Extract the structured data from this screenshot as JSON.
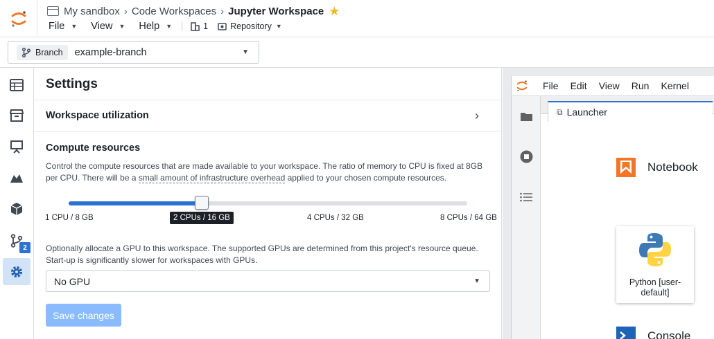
{
  "header": {
    "breadcrumb": [
      "My sandbox",
      "Code Workspaces",
      "Jupyter Workspace"
    ],
    "menu": [
      "File",
      "View",
      "Help"
    ],
    "meta": {
      "count": "1",
      "repository": "Repository"
    }
  },
  "branch": {
    "tag": "Branch",
    "name": "example-branch"
  },
  "rail": {
    "badge": "2",
    "icons": [
      "table-icon",
      "archive-icon",
      "presentation-icon",
      "mountain-chart-icon",
      "cube-icon",
      "git-branch-icon",
      "gear-icon"
    ]
  },
  "settings": {
    "title": "Settings",
    "utilization_label": "Workspace utilization",
    "compute_title": "Compute resources",
    "compute_desc_1": "Control the compute resources that are made available to your workspace. The ratio of memory to CPU is fixed at 8GB per CPU. There will be a ",
    "compute_desc_link": "small amount of infrastructure overhead",
    "compute_desc_2": " applied to your chosen compute resources.",
    "slider": {
      "ticks": [
        "1 CPU / 8 GB",
        "2 CPUs / 16 GB",
        "4 CPUs / 32 GB",
        "8 CPUs / 64 GB"
      ],
      "selected_index": 1,
      "tooltip": "2 CPUs / 16 GB"
    },
    "gpu_desc": "Optionally allocate a GPU to this workspace. The supported GPUs are determined from this project's resource queue. Start-up is significantly slower for workspaces with GPUs.",
    "gpu_value": "No GPU",
    "save_label": "Save changes"
  },
  "jupyter": {
    "menu": [
      "File",
      "Edit",
      "View",
      "Run",
      "Kernel"
    ],
    "tab": "Launcher",
    "notebook_label": "Notebook",
    "kernel_label": "Python [user-default]",
    "console_label": "Console"
  },
  "colors": {
    "accent": "#2d72d2",
    "save_disabled": "#8abbff",
    "active_rail": "#d3e3f7"
  }
}
